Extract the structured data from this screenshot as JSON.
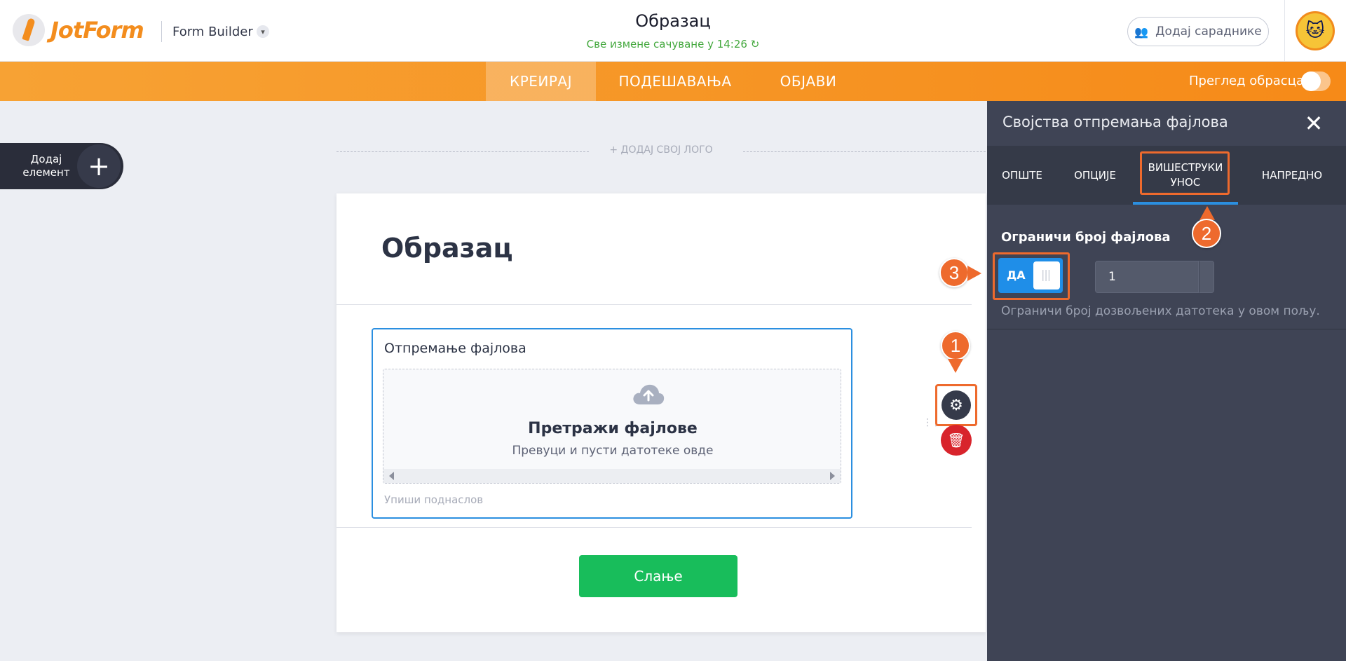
{
  "header": {
    "logo_text": "JotForm",
    "builder_label": "Form Builder",
    "form_title": "Образац",
    "saved_note": "Све измене сачуване у 14:26",
    "collab_button": "Додај сараднике"
  },
  "nav": {
    "tabs": [
      {
        "label": "КРЕИРАЈ",
        "active": true
      },
      {
        "label": "ПОДЕШАВАЊА",
        "active": false
      },
      {
        "label": "ОБЈАВИ",
        "active": false
      }
    ],
    "preview_label": "Преглед обрасца",
    "preview_on": false
  },
  "sidebar": {
    "add_element_label_line1": "Додај",
    "add_element_label_line2": "елемент",
    "add_symbol": "+"
  },
  "canvas": {
    "add_logo": "+ ДОДАЈ СВОЈ ЛОГО",
    "form_heading": "Образац",
    "upload_field": {
      "label": "Отпремање фајлова",
      "browse_title": "Претражи фајлове",
      "browse_sub": "Превуци и пусти датотеке овде",
      "subheading_placeholder": "Упиши поднаслов"
    },
    "submit_label": "Слање"
  },
  "panel": {
    "title": "Својства отпремања фајлова",
    "tabs": [
      {
        "label": "ОПШТЕ"
      },
      {
        "label": "ОПЦИЈЕ"
      },
      {
        "label_line1": "ВИШЕСТРУКИ",
        "label_line2": "УНОС",
        "active": true
      },
      {
        "label": "НАПРЕДНО"
      }
    ],
    "limit_section": {
      "title": "Ограничи број фајлова",
      "toggle_label": "ДА",
      "toggle_on": true,
      "limit_value": "1",
      "description": "Ограничи број дозвољених датотека у овом пољу."
    }
  },
  "callouts": [
    "1",
    "2",
    "3"
  ],
  "colors": {
    "brand_orange": "#f68a18",
    "callout_orange": "#ee6a2d",
    "submit_green": "#18bd5b",
    "accent_blue": "#2b8fe0",
    "delete_red": "#d8242c",
    "panel_bg": "#3f4455"
  },
  "icons": {
    "collab": "users-icon",
    "saved": "refresh-icon",
    "upload": "cloud-upload-icon",
    "settings": "gear-icon",
    "delete": "trash-icon",
    "close": "close-icon"
  }
}
